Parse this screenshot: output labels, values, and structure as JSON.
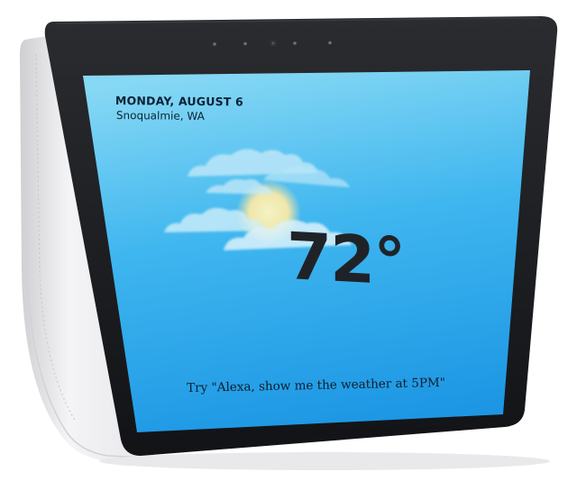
{
  "screen": {
    "date": "MONDAY, AUGUST 6",
    "location": "Snoqualmie, WA",
    "temperature": "72°",
    "hint": "Try \"Alexa, show me the weather at 5PM\""
  },
  "weather_icon": "partly-cloudy-icon",
  "colors": {
    "screen_top": "#7ed4f2",
    "screen_bottom": "#1d9be6",
    "bezel": "#1b1d20",
    "shell": "#ececee"
  }
}
